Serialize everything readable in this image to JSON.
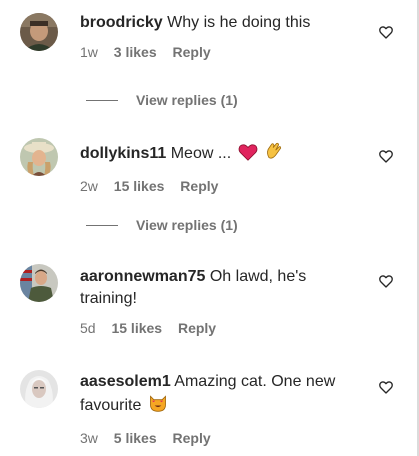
{
  "comments": [
    {
      "username": "broodricky",
      "text": "Why is he doing this",
      "time": "1w",
      "likes": "3 likes",
      "reply": "Reply",
      "view_replies": "View replies (1)"
    },
    {
      "username": "dollykins11",
      "text": "Meow ...",
      "emojis": [
        "red-heart-emoji",
        "clapping-hands-emoji"
      ],
      "time": "2w",
      "likes": "15 likes",
      "reply": "Reply",
      "view_replies": "View replies (1)"
    },
    {
      "username": "aaronnewman75",
      "text": "Oh lawd, he's training!",
      "time": "5d",
      "likes": "15 likes",
      "reply": "Reply"
    },
    {
      "username": "aasesolem1",
      "text": "Amazing cat. One new favourite",
      "emojis": [
        "heart-eyes-cat-emoji"
      ],
      "time": "3w",
      "likes": "5 likes",
      "reply": "Reply"
    }
  ],
  "colors": {
    "text": "#262626",
    "secondary": "#737373",
    "heart_emoji": "#e0245e"
  }
}
